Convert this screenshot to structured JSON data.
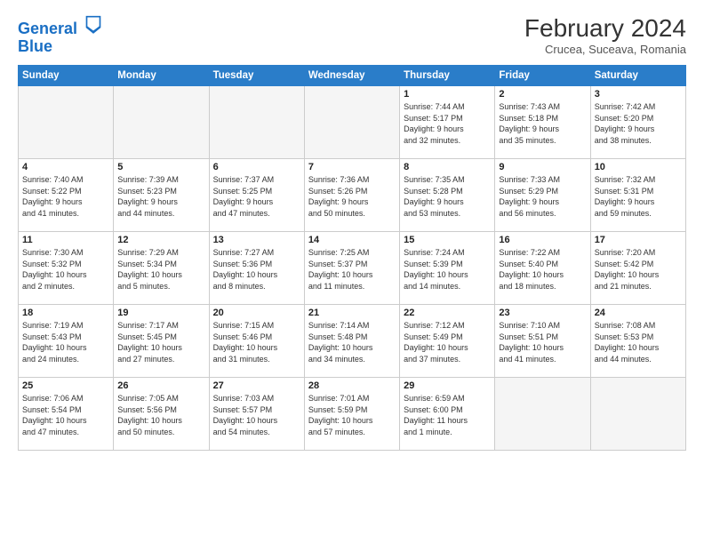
{
  "logo": {
    "line1": "General",
    "line2": "Blue"
  },
  "header": {
    "month": "February 2024",
    "location": "Crucea, Suceava, Romania"
  },
  "weekdays": [
    "Sunday",
    "Monday",
    "Tuesday",
    "Wednesday",
    "Thursday",
    "Friday",
    "Saturday"
  ],
  "weeks": [
    [
      {
        "day": "",
        "detail": ""
      },
      {
        "day": "",
        "detail": ""
      },
      {
        "day": "",
        "detail": ""
      },
      {
        "day": "",
        "detail": ""
      },
      {
        "day": "1",
        "detail": "Sunrise: 7:44 AM\nSunset: 5:17 PM\nDaylight: 9 hours\nand 32 minutes."
      },
      {
        "day": "2",
        "detail": "Sunrise: 7:43 AM\nSunset: 5:18 PM\nDaylight: 9 hours\nand 35 minutes."
      },
      {
        "day": "3",
        "detail": "Sunrise: 7:42 AM\nSunset: 5:20 PM\nDaylight: 9 hours\nand 38 minutes."
      }
    ],
    [
      {
        "day": "4",
        "detail": "Sunrise: 7:40 AM\nSunset: 5:22 PM\nDaylight: 9 hours\nand 41 minutes."
      },
      {
        "day": "5",
        "detail": "Sunrise: 7:39 AM\nSunset: 5:23 PM\nDaylight: 9 hours\nand 44 minutes."
      },
      {
        "day": "6",
        "detail": "Sunrise: 7:37 AM\nSunset: 5:25 PM\nDaylight: 9 hours\nand 47 minutes."
      },
      {
        "day": "7",
        "detail": "Sunrise: 7:36 AM\nSunset: 5:26 PM\nDaylight: 9 hours\nand 50 minutes."
      },
      {
        "day": "8",
        "detail": "Sunrise: 7:35 AM\nSunset: 5:28 PM\nDaylight: 9 hours\nand 53 minutes."
      },
      {
        "day": "9",
        "detail": "Sunrise: 7:33 AM\nSunset: 5:29 PM\nDaylight: 9 hours\nand 56 minutes."
      },
      {
        "day": "10",
        "detail": "Sunrise: 7:32 AM\nSunset: 5:31 PM\nDaylight: 9 hours\nand 59 minutes."
      }
    ],
    [
      {
        "day": "11",
        "detail": "Sunrise: 7:30 AM\nSunset: 5:32 PM\nDaylight: 10 hours\nand 2 minutes."
      },
      {
        "day": "12",
        "detail": "Sunrise: 7:29 AM\nSunset: 5:34 PM\nDaylight: 10 hours\nand 5 minutes."
      },
      {
        "day": "13",
        "detail": "Sunrise: 7:27 AM\nSunset: 5:36 PM\nDaylight: 10 hours\nand 8 minutes."
      },
      {
        "day": "14",
        "detail": "Sunrise: 7:25 AM\nSunset: 5:37 PM\nDaylight: 10 hours\nand 11 minutes."
      },
      {
        "day": "15",
        "detail": "Sunrise: 7:24 AM\nSunset: 5:39 PM\nDaylight: 10 hours\nand 14 minutes."
      },
      {
        "day": "16",
        "detail": "Sunrise: 7:22 AM\nSunset: 5:40 PM\nDaylight: 10 hours\nand 18 minutes."
      },
      {
        "day": "17",
        "detail": "Sunrise: 7:20 AM\nSunset: 5:42 PM\nDaylight: 10 hours\nand 21 minutes."
      }
    ],
    [
      {
        "day": "18",
        "detail": "Sunrise: 7:19 AM\nSunset: 5:43 PM\nDaylight: 10 hours\nand 24 minutes."
      },
      {
        "day": "19",
        "detail": "Sunrise: 7:17 AM\nSunset: 5:45 PM\nDaylight: 10 hours\nand 27 minutes."
      },
      {
        "day": "20",
        "detail": "Sunrise: 7:15 AM\nSunset: 5:46 PM\nDaylight: 10 hours\nand 31 minutes."
      },
      {
        "day": "21",
        "detail": "Sunrise: 7:14 AM\nSunset: 5:48 PM\nDaylight: 10 hours\nand 34 minutes."
      },
      {
        "day": "22",
        "detail": "Sunrise: 7:12 AM\nSunset: 5:49 PM\nDaylight: 10 hours\nand 37 minutes."
      },
      {
        "day": "23",
        "detail": "Sunrise: 7:10 AM\nSunset: 5:51 PM\nDaylight: 10 hours\nand 41 minutes."
      },
      {
        "day": "24",
        "detail": "Sunrise: 7:08 AM\nSunset: 5:53 PM\nDaylight: 10 hours\nand 44 minutes."
      }
    ],
    [
      {
        "day": "25",
        "detail": "Sunrise: 7:06 AM\nSunset: 5:54 PM\nDaylight: 10 hours\nand 47 minutes."
      },
      {
        "day": "26",
        "detail": "Sunrise: 7:05 AM\nSunset: 5:56 PM\nDaylight: 10 hours\nand 50 minutes."
      },
      {
        "day": "27",
        "detail": "Sunrise: 7:03 AM\nSunset: 5:57 PM\nDaylight: 10 hours\nand 54 minutes."
      },
      {
        "day": "28",
        "detail": "Sunrise: 7:01 AM\nSunset: 5:59 PM\nDaylight: 10 hours\nand 57 minutes."
      },
      {
        "day": "29",
        "detail": "Sunrise: 6:59 AM\nSunset: 6:00 PM\nDaylight: 11 hours\nand 1 minute."
      },
      {
        "day": "",
        "detail": ""
      },
      {
        "day": "",
        "detail": ""
      }
    ]
  ]
}
